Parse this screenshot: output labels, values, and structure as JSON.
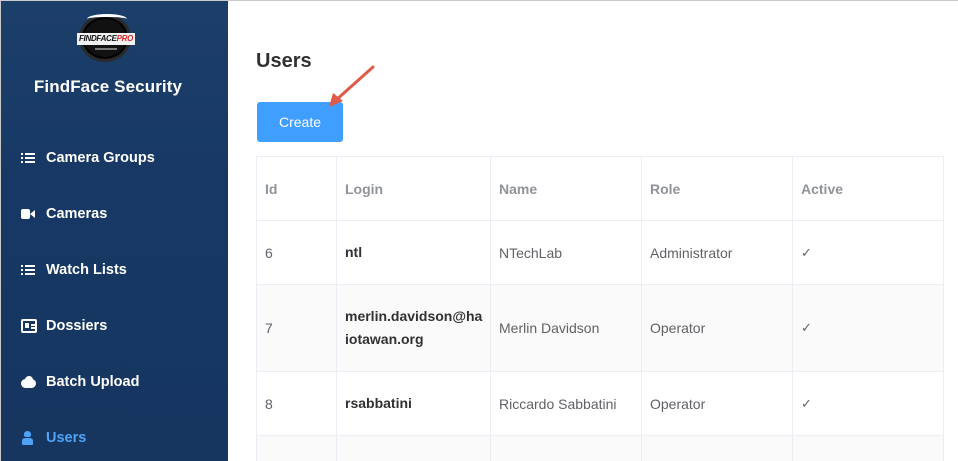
{
  "app": {
    "logo_text_main": "FINDFACE",
    "logo_text_pro": "PRO",
    "brand": "FindFace Security"
  },
  "sidebar": {
    "items": [
      {
        "label": "Camera Groups",
        "icon": "list-icon",
        "active": false
      },
      {
        "label": "Cameras",
        "icon": "camera-icon",
        "active": false
      },
      {
        "label": "Watch Lists",
        "icon": "list-icon",
        "active": false
      },
      {
        "label": "Dossiers",
        "icon": "id-card-icon",
        "active": false
      },
      {
        "label": "Batch Upload",
        "icon": "cloud-upload-icon",
        "active": false
      },
      {
        "label": "Users",
        "icon": "user-icon",
        "active": true
      }
    ]
  },
  "main": {
    "title": "Users",
    "create_label": "Create",
    "annotation": "red-arrow-pointing-to-create"
  },
  "table": {
    "columns": [
      "Id",
      "Login",
      "Name",
      "Role",
      "Active"
    ],
    "rows": [
      {
        "id": "6",
        "login": "ntl",
        "name": "NTechLab",
        "role": "Administrator",
        "active": "✓"
      },
      {
        "id": "7",
        "login": "merlin.davidson@haiotawan.org",
        "name": "Merlin Davidson",
        "role": "Operator",
        "active": "✓"
      },
      {
        "id": "8",
        "login": "rsabbatini",
        "name": "Riccardo Sabbatini",
        "role": "Operator",
        "active": "✓"
      }
    ]
  },
  "colors": {
    "sidebar_bg": "#173864",
    "accent": "#409eff",
    "active_nav": "#4fa3f7",
    "arrow": "#e05a4a"
  }
}
